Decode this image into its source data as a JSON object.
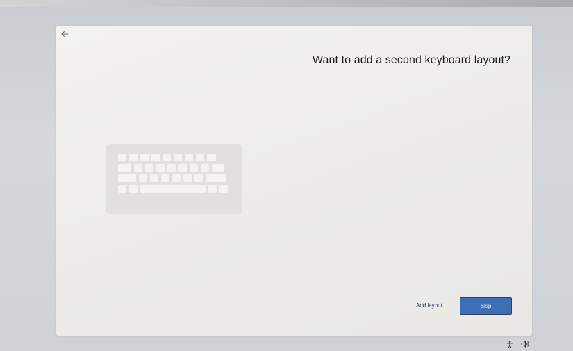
{
  "window": {
    "title": "Want to add a second keyboard layout?"
  },
  "nav": {
    "back_icon": "back-arrow-icon"
  },
  "illustration": {
    "icon": "keyboard-illustration-icon"
  },
  "actions": {
    "add_layout_label": "Add layout",
    "skip_label": "Skip"
  },
  "tray": {
    "accessibility_icon": "accessibility-icon",
    "volume_icon": "volume-icon"
  },
  "colors": {
    "primary_button": "#3d6fb4",
    "window_background": "#f3f2ef",
    "link_text": "#2b3b6b"
  }
}
